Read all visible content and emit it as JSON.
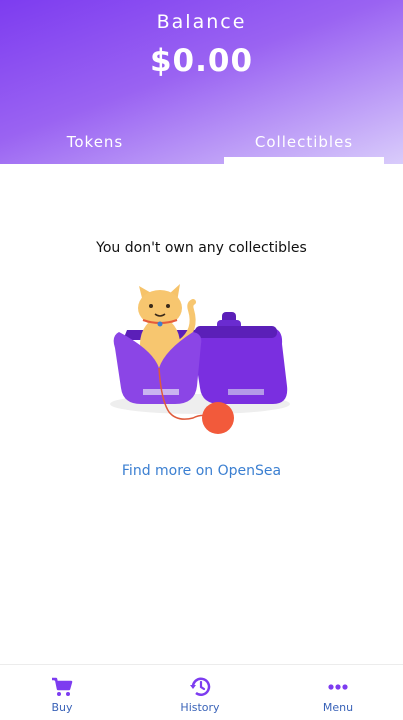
{
  "header": {
    "balance_label": "Balance",
    "balance_value": "$0.00",
    "tabs": [
      {
        "label": "Tokens"
      },
      {
        "label": "Collectibles",
        "selected": true
      }
    ]
  },
  "main": {
    "empty_message": "You don't own any collectibles",
    "link_label": "Find more on OpenSea"
  },
  "bottom_nav": {
    "items": [
      {
        "label": "Buy",
        "icon": "cart-icon"
      },
      {
        "label": "History",
        "icon": "history-icon"
      },
      {
        "label": "Menu",
        "icon": "more-icon"
      }
    ]
  },
  "colors": {
    "accent": "#7d3cf0",
    "link": "#3b7fd1",
    "nav_label": "#3a63b8"
  }
}
